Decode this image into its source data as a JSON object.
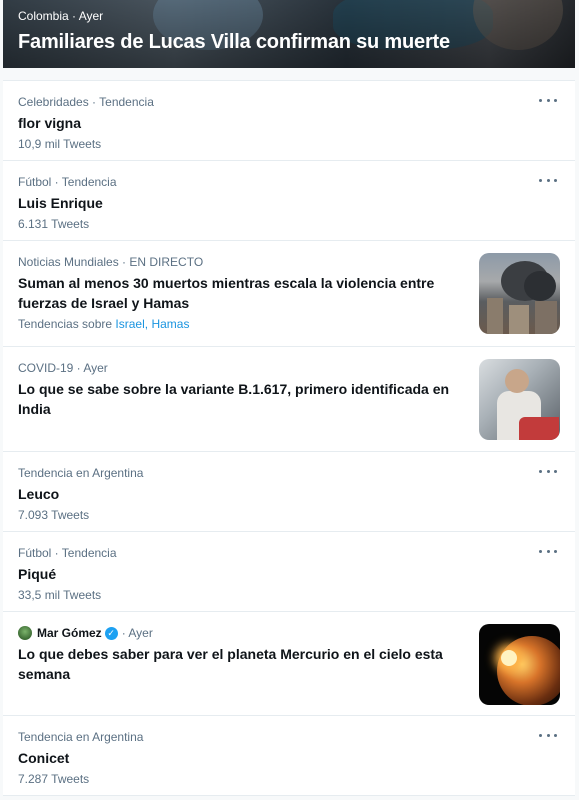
{
  "hero": {
    "meta": "Colombia · Ayer",
    "title": "Familiares de Lucas Villa confirman su muerte"
  },
  "items": [
    {
      "meta": "Celebridades · Tendencia",
      "title": "flor vigna",
      "count": "10,9 mil Tweets"
    },
    {
      "meta": "Fútbol · Tendencia",
      "title": "Luis Enrique",
      "count": "6.131 Tweets"
    },
    {
      "meta": "Noticias Mundiales · EN DIRECTO",
      "title": "Suman al menos 30 muertos mientras escala la violencia entre fuerzas de Israel y Hamas",
      "related_prefix": "Tendencias sobre",
      "related_1": "Israel,",
      "related_2": "Hamas"
    },
    {
      "meta": "COVID-19 · Ayer",
      "title": "Lo que se sabe sobre la variante B.1.617, primero identificada en India"
    },
    {
      "meta": "Tendencia en Argentina",
      "title": "Leuco",
      "count": "7.093 Tweets"
    },
    {
      "meta": "Fútbol · Tendencia",
      "title": "Piqué",
      "count": "33,5 mil Tweets"
    },
    {
      "author": "Mar Gómez",
      "meta": "· Ayer",
      "title": "Lo que debes saber para ver el planeta Mercurio en el cielo esta semana"
    },
    {
      "meta": "Tendencia en Argentina",
      "title": "Conicet",
      "count": "7.287 Tweets"
    }
  ],
  "icons": {
    "more": "more-horizontal-icon",
    "verified": "verified-badge-icon",
    "verified_glyph": "✓"
  },
  "colors": {
    "link": "#1b95e0",
    "secondary_text": "#5b7083",
    "verified": "#1da1f2"
  }
}
